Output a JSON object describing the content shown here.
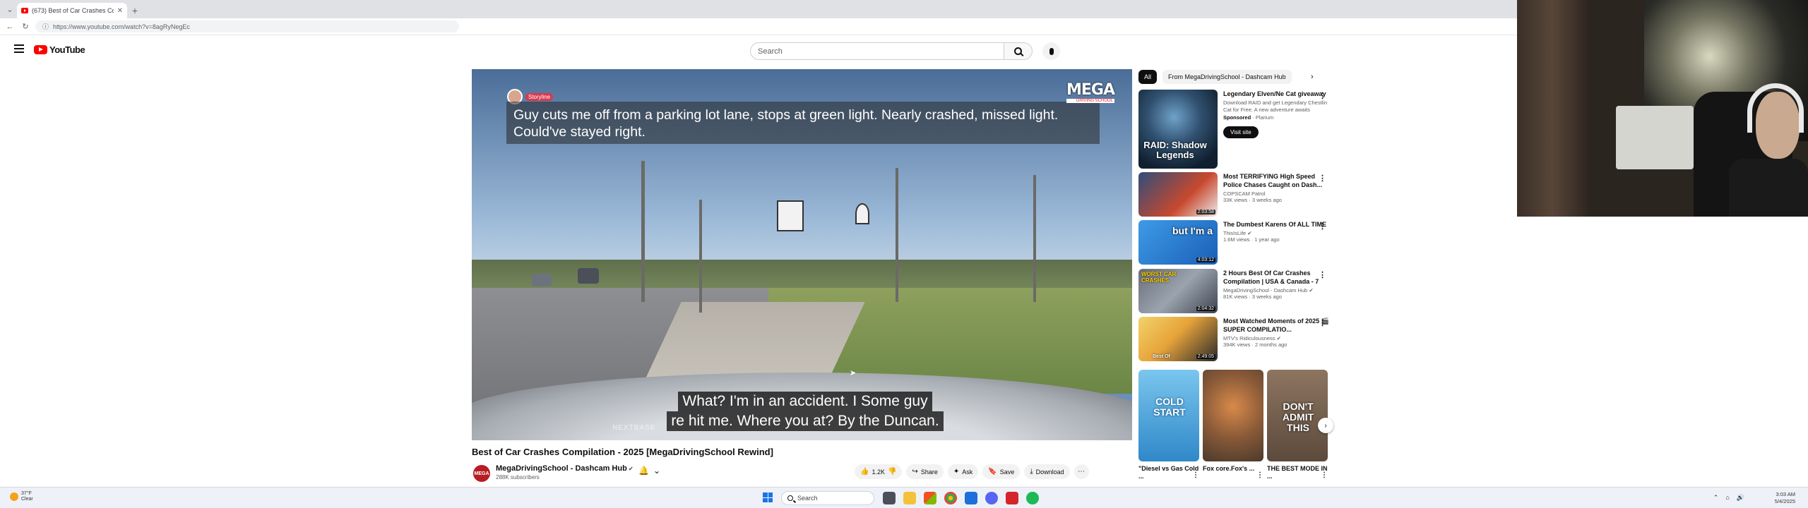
{
  "browser": {
    "tab_title": "(673) Best of Car Crashes Co",
    "url": "https://www.youtube.com/watch?v=8agRyNegEc"
  },
  "youtube": {
    "logo_text": "YouTube",
    "search_placeholder": "Search"
  },
  "player": {
    "top_caption": "Guy cuts me off from a parking lot lane, stops at green light. Nearly crashed, missed light. Could've stayed right.",
    "storyline_label": "Storyline",
    "brand_title": "MEGA",
    "brand_sub": "DRIVING SCHOOL",
    "subtitle_line1": "What? I'm in an accident. I Some guy",
    "subtitle_line2": "re hit me. Where you at? By the Duncan.",
    "dashcam_brand": "NEXTBASE"
  },
  "video": {
    "title": "Best of Car Crashes Compilation - 2025 [MegaDrivingSchool Rewind]",
    "channel_name": "MegaDrivingSchool - Dashcam Hub",
    "channel_avatar_text": "MEGA",
    "subscribers": "288K subscribers",
    "likes": "1.2K",
    "share_label": "Share",
    "ask_label": "Ask",
    "save_label": "Save",
    "download_label": "Download"
  },
  "sidebar": {
    "chips": [
      "All",
      "From MegaDrivingSchool - Dashcam Hub"
    ],
    "ad": {
      "title": "Legendary Elven/Ne Cat giveaway",
      "desc": "Download RAID and get Legendary Chestlin Cat for Free. A new adventure awaits",
      "sponsored": "Sponsored",
      "advertiser": "Plarium",
      "thumb_text": "RAID: Shadow Legends",
      "cta": "Visit site"
    },
    "recommendations": [
      {
        "title": "Most TERRIFYING High Speed Police Chases Caught on Dash...",
        "channel": "COPSCAM Patrol",
        "views": "33K views · 3 weeks ago",
        "duration": "2:03:58"
      },
      {
        "title": "The Dumbest Karens Of ALL TIME",
        "channel": "ThisIsLife",
        "views": "1.6M views · 1 year ago",
        "duration": "4:03:12",
        "thumb_text": "but I'm a"
      },
      {
        "title": "2 Hours Best Of Car Crashes Compilation | USA & Canada - 7",
        "channel": "MegaDrivingSchool - Dashcam Hub",
        "views": "81K views · 3 weeks ago",
        "duration": "2:04:32",
        "thumb_text": "WORST CAR CRASHES"
      },
      {
        "title": "Most Watched Moments of 2025 🎬 SUPER COMPILATIO...",
        "channel": "MTV's Ridiculousness",
        "views": "394K views · 2 months ago",
        "duration": "2:49:05",
        "thumb_text": "Best Of"
      }
    ],
    "shorts": [
      {
        "title": "\"Diesel vs Gas Cold ...",
        "thumb_text": "COLD START"
      },
      {
        "title": "Fox core.Fox's ...",
        "thumb_text": ""
      },
      {
        "title": "THE BEST MODE IN ...",
        "thumb_text": "DON'T ADMIT THIS"
      }
    ]
  },
  "taskbar": {
    "weather_temp": "37°F",
    "weather_desc": "Clear",
    "search_label": "Search",
    "time": "3:03 AM",
    "date": "5/4/2025"
  },
  "colors": {
    "youtube_red": "#ff0000",
    "chip_active": "#0f0f0f",
    "taskbar_bg": "#eef1f7"
  }
}
